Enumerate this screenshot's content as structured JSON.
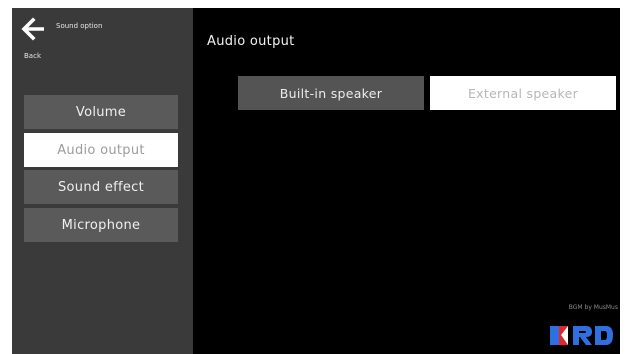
{
  "header": {
    "back_label": "Back",
    "screen_title": "Sound option"
  },
  "sidebar": {
    "items": [
      {
        "label": "Volume",
        "active": false
      },
      {
        "label": "Audio output",
        "active": true
      },
      {
        "label": "Sound effect",
        "active": false
      },
      {
        "label": "Microphone",
        "active": false
      }
    ]
  },
  "main": {
    "title": "Audio output",
    "options": [
      {
        "label": "Built-in speaker",
        "selected": false
      },
      {
        "label": "External speaker",
        "selected": true
      }
    ],
    "credit": "BGM by MusMus"
  },
  "colors": {
    "screen_bg": "#000000",
    "sidebar_bg": "#3a3a3a",
    "button_bg": "#5a5a5a",
    "selected_bg": "#ffffff",
    "logo_blue": "#2f6fe0",
    "logo_red": "#e0272b"
  },
  "icons": {
    "back": "arrow-left-icon",
    "logo": "brand-logo-icon"
  }
}
